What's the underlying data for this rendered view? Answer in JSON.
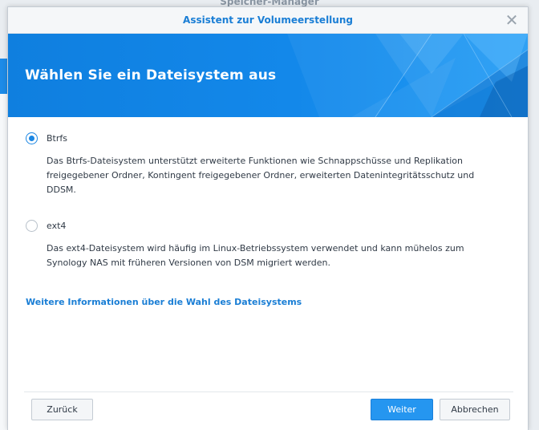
{
  "background_app": {
    "title": "Speicher-Manager"
  },
  "dialog": {
    "title": "Assistent zur Volumeerstellung",
    "close_icon": "close-icon",
    "banner_title": "Wählen Sie ein Dateisystem aus",
    "options": [
      {
        "label": "Btrfs",
        "checked": true,
        "description": "Das Btrfs-Dateisystem unterstützt erweiterte Funktionen wie Schnappschüsse und Replikation freigegebener Ordner, Kontingent freigegebener Ordner, erweiterten Datenintegritätsschutz und DDSM."
      },
      {
        "label": "ext4",
        "checked": false,
        "description": "Das ext4-Dateisystem wird häufig im Linux-Betriebssystem verwendet und kann mühelos zum Synology NAS mit früheren Versionen von DSM migriert werden."
      }
    ],
    "more_info_link": "Weitere Informationen über die Wahl des Dateisystems",
    "buttons": {
      "back": "Zurück",
      "next": "Weiter",
      "cancel": "Abbrechen"
    }
  },
  "colors": {
    "accent": "#1a7ed5",
    "primary_button": "#2596f0",
    "banner": "#1388ea"
  }
}
